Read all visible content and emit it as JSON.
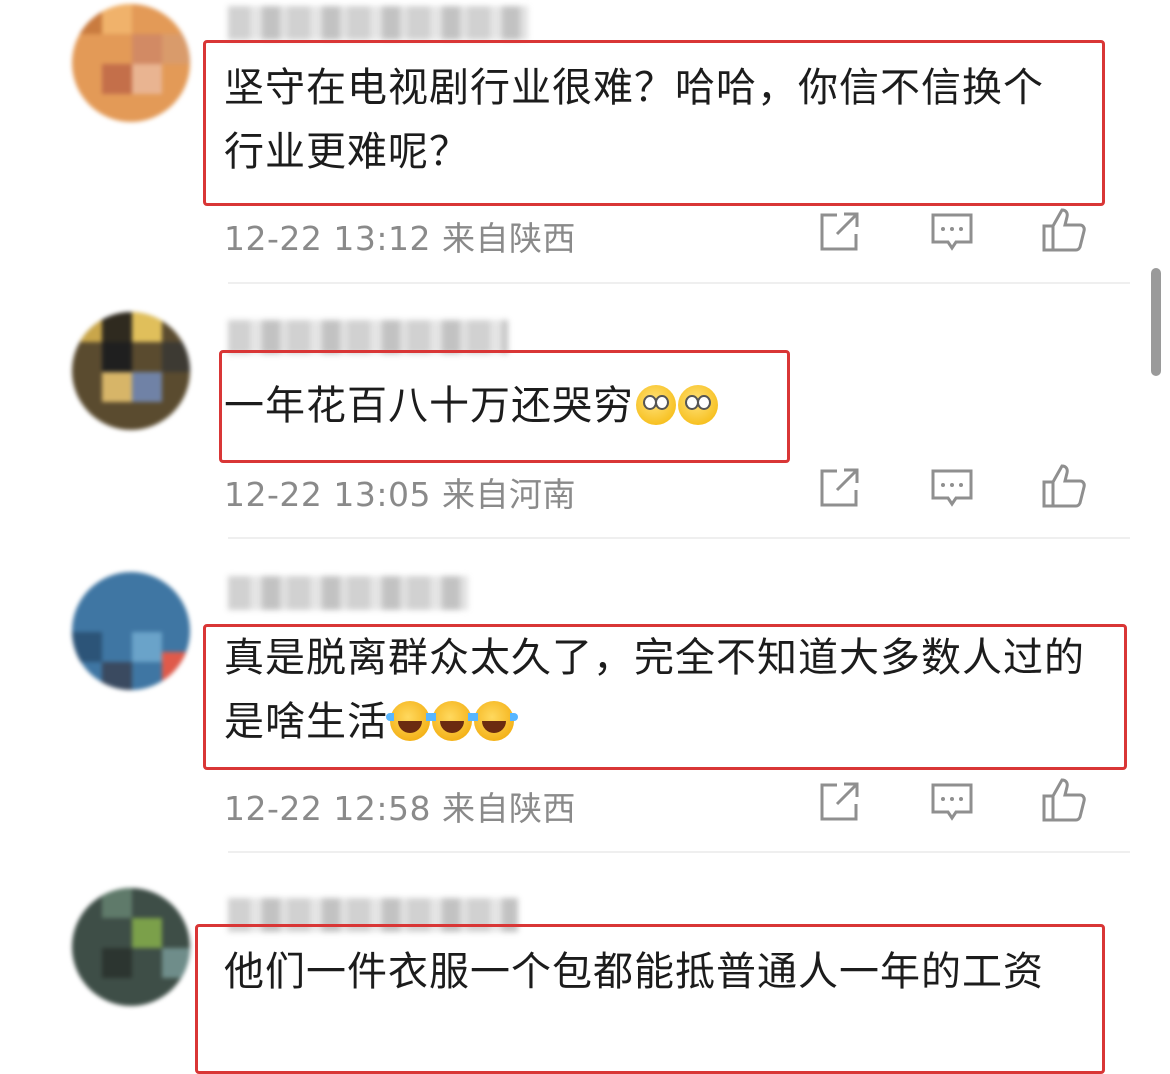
{
  "comments": [
    {
      "text": "坚守在电视剧行业很难？哈哈，你信不信换个行业更难呢？",
      "time": "12-22 13:12",
      "location": "来自陕西",
      "emojis": []
    },
    {
      "text": "一年花百八十万还哭穷",
      "time": "12-22 13:05",
      "location": "来自河南",
      "emojis": [
        "eye-roll-emoji",
        "eye-roll-emoji"
      ]
    },
    {
      "text": "真是脱离群众太久了，完全不知道大多数人过的是啥生活",
      "time": "12-22 12:58",
      "location": "来自陕西",
      "emojis": [
        "laugh-cry-emoji",
        "laugh-cry-emoji",
        "laugh-cry-emoji"
      ]
    },
    {
      "text": "他们一件衣服一个包都能抵普通人一年的工资",
      "time": "",
      "location": "",
      "emojis": []
    }
  ],
  "colors": {
    "highlight_box": "#d93636",
    "meta_text": "#8a8a8a",
    "icon_gray": "#8f8f8f"
  },
  "icons": [
    "share-icon",
    "comment-icon",
    "like-icon"
  ]
}
